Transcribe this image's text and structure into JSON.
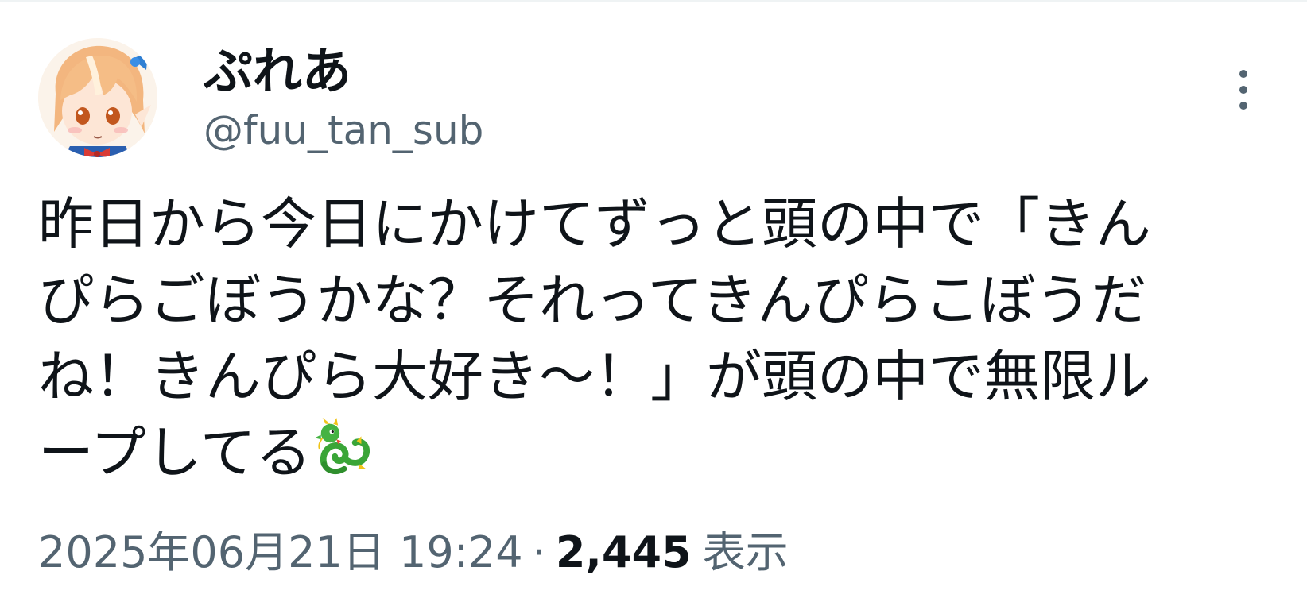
{
  "tweet": {
    "author": {
      "display_name": "ぷれあ",
      "handle": "@fuu_tan_sub",
      "avatar_icon": "anime-character-avatar"
    },
    "more_icon": "more-vertical-icon",
    "text_lines": [
      "昨日から今日にかけてずっと頭の中で「きん",
      "ぴらごぼうかな？それってきんぴらこぼうだ",
      "ね！きんぴら大好き～！」が頭の中で無限ル",
      "ープしてる"
    ],
    "text_emoji": "dragon-icon",
    "meta": {
      "datetime": "2025年06月21日 19:24",
      "separator": "·",
      "views_count": "2,445",
      "views_label": "表示"
    }
  },
  "colors": {
    "text_primary": "#0f1419",
    "text_secondary": "#536471",
    "background": "#ffffff"
  }
}
